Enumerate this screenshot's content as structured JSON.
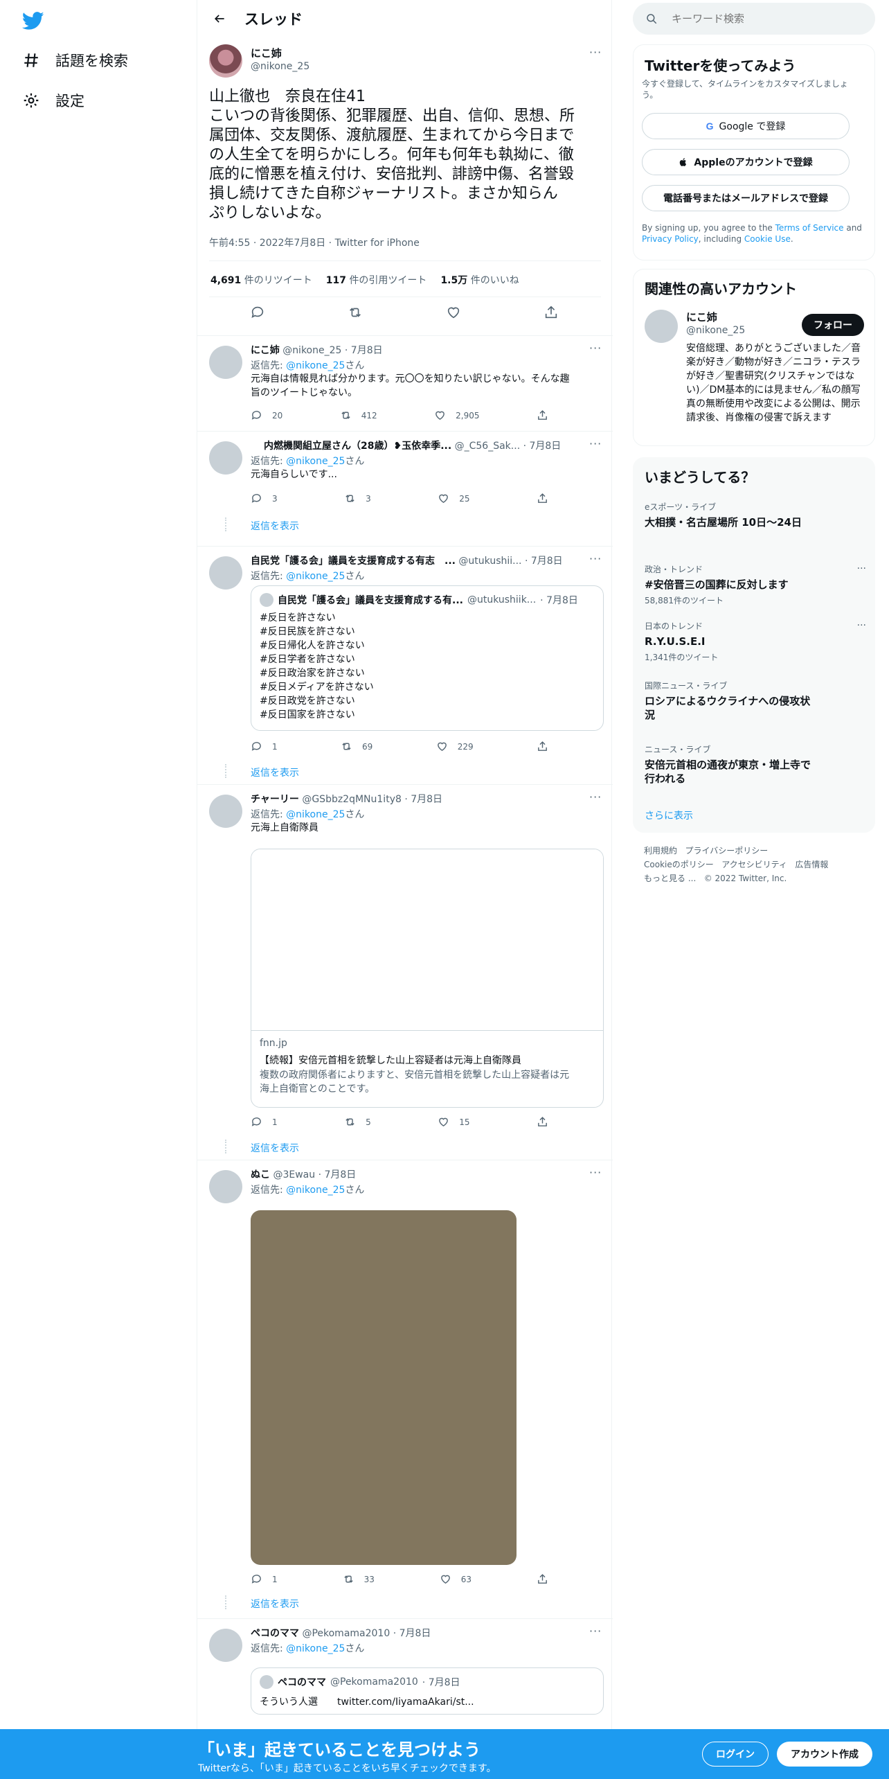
{
  "nav": {
    "items": [
      {
        "label": "話題を検索",
        "icon": "hashtag-icon"
      },
      {
        "label": "設定",
        "icon": "gear-icon"
      }
    ]
  },
  "header": {
    "title": "スレッド"
  },
  "main_tweet": {
    "name": "にこ姉",
    "handle": "@nikone_25",
    "text_lines": [
      "山上徹也　奈良在住41",
      "こいつの背後関係、犯罪履歴、出自、信仰、思想、所",
      "属団体、交友関係、渡航履歴、生まれてから今日まで",
      "の人生全てを明らかにしろ。何年も何年も執拗に、徹",
      "底的に憎悪を植え付け、安倍批判、誹謗中傷、名誉毀",
      "損し続けてきた自称ジャーナリスト。まさか知らん",
      "ぷりしないよな。"
    ],
    "meta": "午前4:55 · 2022年7月8日 · Twitter for iPhone",
    "retweets_count": "4,691",
    "retweets_label": "件のリツイート",
    "quotes_count": "117",
    "quotes_label": "件の引用ツイート",
    "likes_count": "1.5万",
    "likes_label": "件のいいね"
  },
  "replies": [
    {
      "name": "にこ姉",
      "handle": "@nikone_25",
      "date": "· 7月8日",
      "reply_to_prefix": "返信先: ",
      "reply_to": "@nikone_25",
      "reply_to_suffix": "さん",
      "text_lines": [
        "元海自は情報見れば分かります。元〇〇を知りたい訳じゃない。そんな趣",
        "旨のツイートじゃない。"
      ],
      "replies": "20",
      "retweets": "412",
      "likes": "2,905"
    },
    {
      "name": "内燃機関組立屋さん（28歳）❥玉依幸季...",
      "handle": "@_C56_Sak...",
      "date": "· 7月8日",
      "reply_to_prefix": "返信先: ",
      "reply_to": "@nikone_25",
      "reply_to_suffix": "さん",
      "text_lines": [
        "元海自らしいです..."
      ],
      "replies": "3",
      "retweets": "3",
      "likes": "25",
      "show_replies": "返信を表示"
    },
    {
      "name": "自民党「護る会」議員を支援育成する有志　...",
      "handle": "@utukushii...",
      "date": "· 7月8日",
      "reply_to_prefix": "返信先: ",
      "reply_to": "@nikone_25",
      "reply_to_suffix": "さん",
      "quote": {
        "name": "自民党「護る会」議員を支援育成する有...",
        "handle": "@utukushiik...",
        "date": "· 7月8日",
        "lines": [
          "#反日を許さない",
          "#反日民族を許さない",
          "#反日帰化人を許さない",
          "#反日学者を許さない",
          "#反日政治家を許さない",
          "#反日メディアを許さない",
          "#反日政党を許さない",
          "#反日国家を許さない"
        ]
      },
      "replies": "1",
      "retweets": "69",
      "likes": "229",
      "show_replies": "返信を表示"
    },
    {
      "name": "チャーリー",
      "handle": "@GSbbz2qMNu1ity8",
      "date": "· 7月8日",
      "reply_to_prefix": "返信先: ",
      "reply_to": "@nikone_25",
      "reply_to_suffix": "さん",
      "text_lines": [
        "元海上自衛隊員"
      ],
      "link_card": {
        "domain": "fnn.jp",
        "title": "【続報】安倍元首相を銃撃した山上容疑者は元海上自衛隊員",
        "desc_lines": [
          "複数の政府関係者によりますと、安倍元首相を銃撃した山上容疑者は元",
          "海上自衛官とのことです。"
        ]
      },
      "replies": "1",
      "retweets": "5",
      "likes": "15",
      "show_replies": "返信を表示"
    },
    {
      "name": "ぬこ",
      "handle": "@3Ewau",
      "date": "· 7月8日",
      "reply_to_prefix": "返信先: ",
      "reply_to": "@nikone_25",
      "reply_to_suffix": "さん",
      "media_color": "#82765e",
      "replies": "1",
      "retweets": "33",
      "likes": "63",
      "show_replies": "返信を表示"
    },
    {
      "name": "ペコのママ",
      "handle": "@Pekomama2010",
      "date": "· 7月8日",
      "reply_to_prefix": "返信先: ",
      "reply_to": "@nikone_25",
      "reply_to_suffix": "さん",
      "quote": {
        "name": "ペコのママ",
        "handle": "@Pekomama2010",
        "date": "· 7月8日",
        "lines": [
          "そういう人選　　twitter.com/IiyamaAkari/st..."
        ]
      }
    }
  ],
  "right": {
    "search_placeholder": "キーワード検索",
    "signup": {
      "title": "Twitterを使ってみよう",
      "sub": "今すぐ登録して、タイムラインをカスタマイズしましょう。",
      "google": "Google で登録",
      "apple": "Appleのアカウントで登録",
      "phone": "電話番号またはメールアドレスで登録",
      "terms_pre": "By signing up, you agree to the ",
      "terms": "Terms of Service",
      "terms_and": " and ",
      "privacy": "Privacy Policy",
      "terms_mid": ", including ",
      "cookie": "Cookie Use",
      "terms_end": "."
    },
    "related": {
      "title": "関連性の高いアカウント",
      "name": "にこ姉",
      "handle": "@nikone_25",
      "follow": "フォロー",
      "bio": "安倍総理、ありがとうございました／音楽が好き／動物が好き／ニコラ・テスラが好き／聖書研究(クリスチャンではない)／DM基本的には見ません／私の顔写真の無断使用や改変による公開は、開示請求後、肖像権の侵害で訴えます"
    },
    "trends": {
      "title": "いまどうしてる？",
      "items": [
        {
          "cat": "eスポーツ・ライブ",
          "title": "大相撲・名古屋場所 10日〜24日",
          "count": ""
        },
        {
          "cat": "政治・トレンド",
          "title": "#安倍晋三の国葬に反対します",
          "count": "58,881件のツイート"
        },
        {
          "cat": "日本のトレンド",
          "title": "R.Y.U.S.E.I",
          "count": "1,341件のツイート"
        },
        {
          "cat": "国際ニュース・ライブ",
          "title": "ロシアによるウクライナへの侵攻状況",
          "count": ""
        },
        {
          "cat": "ニュース・ライブ",
          "title": "安倍元首相の通夜が東京・増上寺で行われる",
          "count": ""
        }
      ],
      "more": "さらに表示"
    },
    "footer": {
      "line1": [
        "利用規約",
        "プライバシーポリシー"
      ],
      "line2": [
        "Cookieのポリシー",
        "アクセシビリティ",
        "広告情報"
      ],
      "more": "もっと見る ...",
      "copy": "© 2022 Twitter, Inc."
    }
  },
  "banner": {
    "headline": "「いま」起きていることを見つけよう",
    "sub": "Twitterなら、「いま」起きていることをいち早くチェックできます。",
    "login": "ログイン",
    "signup": "アカウント作成"
  }
}
